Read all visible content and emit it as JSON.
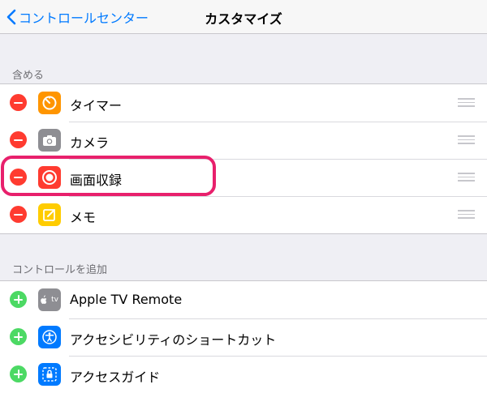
{
  "nav": {
    "back_label": "コントロールセンター",
    "title": "カスタマイズ"
  },
  "included": {
    "header": "含める",
    "items": [
      {
        "label": "タイマー",
        "icon": "timer-icon",
        "color": "#ff9500"
      },
      {
        "label": "カメラ",
        "icon": "camera-icon",
        "color": "#8e8e93"
      },
      {
        "label": "画面収録",
        "icon": "screen-record-icon",
        "color": "#ff3b30"
      },
      {
        "label": "メモ",
        "icon": "notes-icon",
        "color": "#ffcc00"
      }
    ]
  },
  "more": {
    "header": "コントロールを追加",
    "items": [
      {
        "label": "Apple TV Remote",
        "icon": "apple-tv-remote-icon",
        "color": "#8e8e93",
        "icon_text": "tv"
      },
      {
        "label": "アクセシビリティのショートカット",
        "icon": "accessibility-icon",
        "color": "#007aff"
      },
      {
        "label": "アクセスガイド",
        "icon": "guided-access-icon",
        "color": "#007aff"
      }
    ]
  },
  "colors": {
    "accent": "#007aff",
    "remove": "#ff3b30",
    "add": "#4cd964",
    "highlight": "#e8206c"
  }
}
